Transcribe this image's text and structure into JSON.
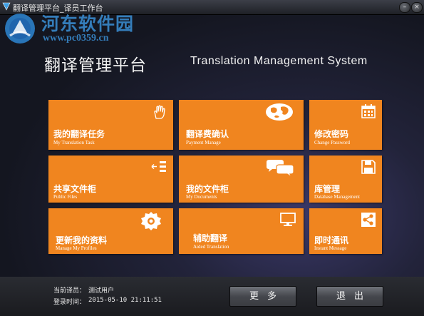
{
  "window": {
    "title": "翻译管理平台_译员工作台",
    "minimize_glyph": "–",
    "close_glyph": "×"
  },
  "watermark": {
    "name": "河东软件园",
    "url": "www.pc0359.cn"
  },
  "header": {
    "title_cn": "翻译管理平台",
    "title_en": "Translation Management System"
  },
  "tiles": [
    {
      "cn": "我的翻译任务",
      "en": "My Translation Task",
      "icon": "hand-pointer-icon"
    },
    {
      "cn": "翻译费确认",
      "en": "Payment Manage",
      "icon": "globe-icon"
    },
    {
      "cn": "修改密码",
      "en": "Change Password",
      "icon": "calendar-icon"
    },
    {
      "cn": "共享文件柜",
      "en": "Public Files",
      "icon": "list-arrow-icon"
    },
    {
      "cn": "我的文件柜",
      "en": "My Documents",
      "icon": "chat-bubbles-icon"
    },
    {
      "cn": "库管理",
      "en": "Database Management",
      "icon": "floppy-disk-icon"
    },
    {
      "cn": "更新我的资料",
      "en": "Manage My Profiles",
      "icon": "badge-icon"
    },
    {
      "cn": "辅助翻译",
      "en": "Aided Translation",
      "icon": "monitor-icon"
    },
    {
      "cn": "即时通讯",
      "en": "Instant Message",
      "icon": "share-icon"
    }
  ],
  "footer": {
    "user_label": "当前译员：",
    "user_value": "测试用户",
    "login_label": "登录时间：",
    "login_value": "2015-05-10 21:11:51",
    "more_button": "更多",
    "exit_button": "退出"
  },
  "colors": {
    "tile": "#f0851f",
    "background": "#22233a",
    "watermark": "#3a8fd6"
  }
}
